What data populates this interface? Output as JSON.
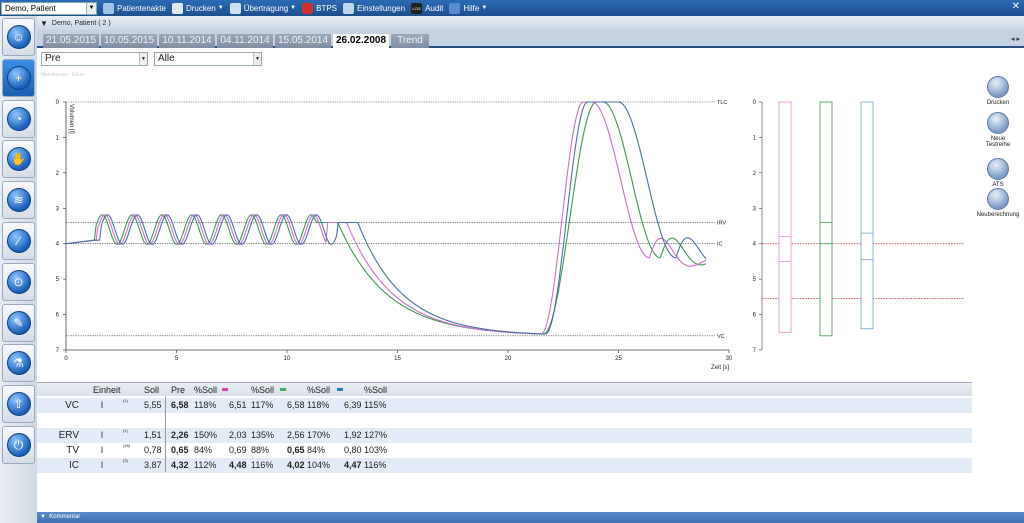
{
  "topbar": {
    "patient": "Demo, Patient",
    "items": [
      {
        "label": "Patientenakte",
        "icon": "folder-icon",
        "dd": false
      },
      {
        "label": "Drucken",
        "icon": "printer-icon",
        "dd": true
      },
      {
        "label": "Übertragung",
        "icon": "transfer-icon",
        "dd": true
      },
      {
        "label": "BTPS",
        "icon": "thermometer-icon",
        "dd": false
      },
      {
        "label": "Einstellungen",
        "icon": "settings-icon",
        "dd": false
      },
      {
        "label": "Audit",
        "icon": "log-icon",
        "icon_text": "LOG",
        "dd": false
      },
      {
        "label": "Hilfe",
        "icon": "help-icon",
        "dd": true
      }
    ]
  },
  "header": {
    "patient": "Demo, Patient ( 2 )"
  },
  "tabs": [
    "21.05.2015",
    "10.05.2015",
    "10.11.2014",
    "04.11.2014",
    "15.05.2014",
    "26.02.2008",
    "Trend"
  ],
  "active_tab": "26.02.2008",
  "filters": {
    "test": "Pre",
    "scope": "Alle"
  },
  "legend": {
    "a": "Messkurven",
    "b": "Einze"
  },
  "right_actions": [
    {
      "label": "Drucken",
      "icon": "printer-icon"
    },
    {
      "label": "Neue\nTestreihe",
      "icon": "add-test-icon"
    },
    {
      "label": "ATS",
      "icon": "ats-icon"
    },
    {
      "label": "Neuberechnung",
      "icon": "recalc-icon"
    }
  ],
  "chart_data": {
    "type": "line",
    "xlabel": "Zeit [s]",
    "ylabel": "Volumen [l]",
    "xlim": [
      0,
      30
    ],
    "ylim": [
      0,
      7
    ],
    "xticks": [
      0,
      5,
      10,
      15,
      20,
      25,
      30
    ],
    "yticks": [
      0,
      1,
      2,
      3,
      4,
      5,
      6,
      7
    ],
    "reference_lines": [
      {
        "name": "TLC",
        "y": 0
      },
      {
        "name": "IRV",
        "y": 3.4
      },
      {
        "name": "IC",
        "y": 4.0
      },
      {
        "name": "VC",
        "y": 6.6
      }
    ],
    "colors": {
      "pink": "#d070c8",
      "green": "#3a9a50",
      "blue": "#4a70a8"
    },
    "bars": [
      {
        "color": "#e090d8",
        "top": 0,
        "bottom": 6.5,
        "mark": 4.5,
        "line": 3.8
      },
      {
        "color": "#3a9a50",
        "top": 0,
        "bottom": 6.6,
        "mark": 4.0,
        "line": 3.4
      },
      {
        "color": "#6aa8c8",
        "top": 0,
        "bottom": 6.4,
        "mark": 4.45,
        "line": 3.7
      }
    ],
    "bar_refs": [
      4.0,
      5.55
    ]
  },
  "table": {
    "headers": {
      "unit": "Einheit",
      "soll": "Soll",
      "pre": "Pre",
      "p1": "%Soll",
      "p2": "%Soll",
      "p3": "%Soll",
      "p4": "%Soll"
    },
    "legend_colors": [
      "#e040b0",
      "#40b060",
      "#2080b0"
    ],
    "rows": [
      {
        "name": "VC",
        "unit": "l",
        "sup": "(1)",
        "soll": "5,55",
        "pre": "6,58",
        "ps": "118%",
        "a": "6,51",
        "as": "117%",
        "b": "6,58",
        "bs": "118%",
        "c": "6,39",
        "cs": "115%",
        "bold": [
          "pre"
        ]
      },
      {
        "name": "",
        "unit": "",
        "sup": "",
        "soll": "",
        "pre": "",
        "ps": "",
        "a": "",
        "as": "",
        "b": "",
        "bs": "",
        "c": "",
        "cs": "",
        "bold": []
      },
      {
        "name": "ERV",
        "unit": "l",
        "sup": "(1)",
        "soll": "1,51",
        "pre": "2,26",
        "ps": "150%",
        "a": "2,03",
        "as": "135%",
        "b": "2,56",
        "bs": "170%",
        "c": "1,92",
        "cs": "127%",
        "bold": [
          "pre"
        ]
      },
      {
        "name": "TV",
        "unit": "l",
        "sup": "(28)",
        "soll": "0,78",
        "pre": "0,65",
        "ps": "84%",
        "a": "0,69",
        "as": "88%",
        "b": "0,65",
        "bs": "84%",
        "c": "0,80",
        "cs": "103%",
        "bold": [
          "pre",
          "b"
        ]
      },
      {
        "name": "IC",
        "unit": "l",
        "sup": "(3)",
        "soll": "3,87",
        "pre": "4,32",
        "ps": "112%",
        "a": "4,48",
        "as": "116%",
        "b": "4,02",
        "bs": "104%",
        "c": "4,47",
        "cs": "116%",
        "bold": [
          "pre",
          "a",
          "b",
          "c"
        ]
      }
    ]
  },
  "footer": {
    "label": "Kommentar"
  }
}
